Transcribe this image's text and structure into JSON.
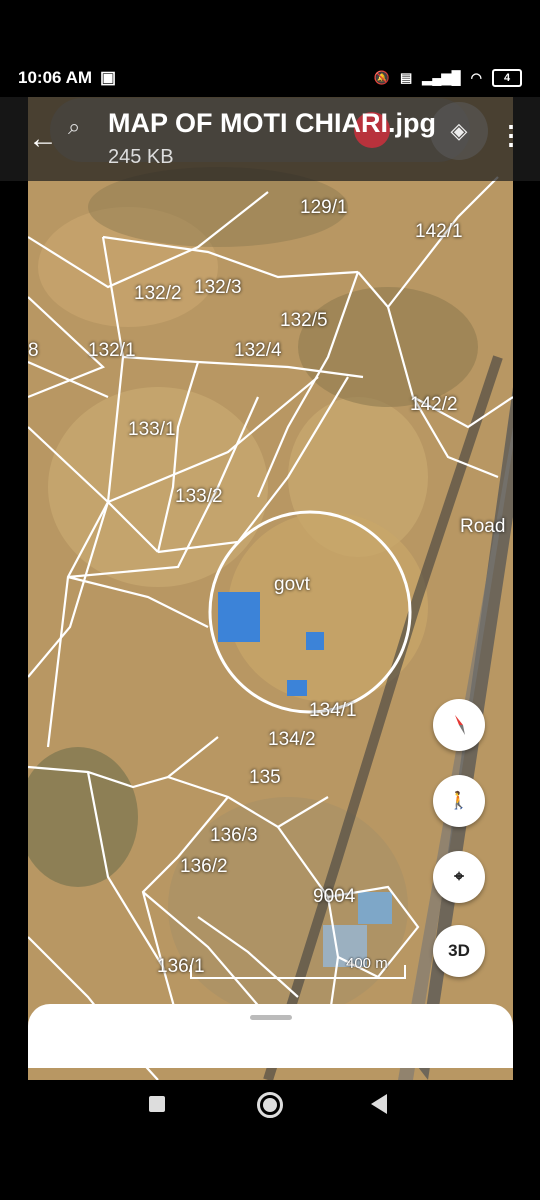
{
  "status": {
    "time": "10:06 AM",
    "battery_level": "4",
    "icons": [
      "sim-icon",
      "mute-icon",
      "volte-icon",
      "signal-icon",
      "wifi-icon",
      "battery-icon"
    ]
  },
  "header": {
    "title": "MAP OF MOTI CHIARI.jpg",
    "subtitle": "245 KB"
  },
  "map": {
    "labels": {
      "p129_1": "129/1",
      "p142_1": "142/1",
      "p132_2": "132/2",
      "p132_3": "132/3",
      "p132_5": "132/5",
      "p132_4": "132/4",
      "p132_1": "132/1",
      "p8": "8",
      "p142_2": "142/2",
      "p133_1": "133/1",
      "p133_2": "133/2",
      "road": "Road",
      "govt": "govt",
      "p134_1": "134/1",
      "p134_2": "134/2",
      "p135": "135",
      "p136_3": "136/3",
      "p136_2": "136/2",
      "p9004": "9004",
      "p136_1": "136/1"
    },
    "scale": "400 m"
  },
  "controls": {
    "compass": "compass-icon",
    "street_view": "pegman-icon",
    "location": "my-location-icon",
    "three_d": "3D"
  }
}
